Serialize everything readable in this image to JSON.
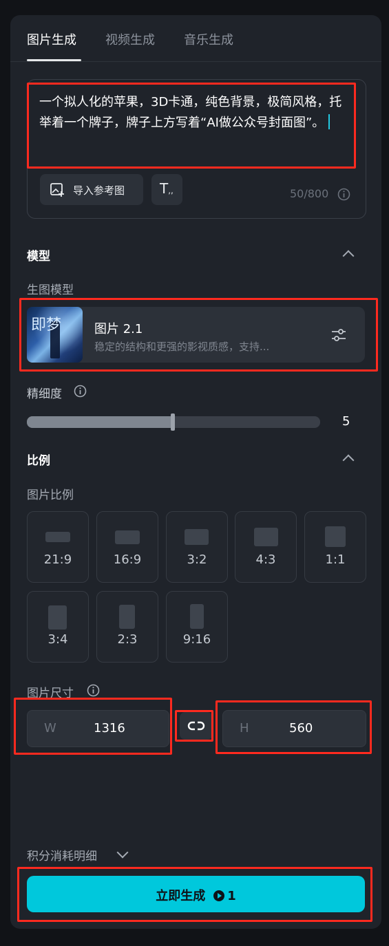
{
  "tabs": [
    {
      "label": "图片生成",
      "active": true
    },
    {
      "label": "视频生成",
      "active": false
    },
    {
      "label": "音乐生成",
      "active": false
    }
  ],
  "prompt": {
    "text": "一个拟人化的苹果，3D卡通，纯色背景，极简风格，托举着一个牌子，牌子上方写着“AI做公众号封面图”。",
    "import_ref_label": "导入参考图",
    "char_count": "50/800"
  },
  "model": {
    "section_title": "模型",
    "sub_title": "生图模型",
    "name": "图片 2.1",
    "description": "稳定的结构和更强的影视质感，支持...",
    "thumbnail_text": "即梦"
  },
  "detail": {
    "label": "精细度",
    "value": "5",
    "fraction": 0.5
  },
  "ratio": {
    "section_title": "比例",
    "sub_title": "图片比例",
    "options": [
      "21:9",
      "16:9",
      "3:2",
      "4:3",
      "1:1",
      "3:4",
      "2:3",
      "9:16"
    ]
  },
  "size": {
    "label": "图片尺寸",
    "width_key": "W",
    "width": "1316",
    "height_key": "H",
    "height": "560"
  },
  "cost": {
    "detail_label": "积分消耗明细"
  },
  "generate": {
    "label": "立即生成",
    "cost": "1"
  },
  "colors": {
    "accent": "#00c8dc",
    "highlight": "#ff2a1f",
    "panel": "#1f232a"
  }
}
